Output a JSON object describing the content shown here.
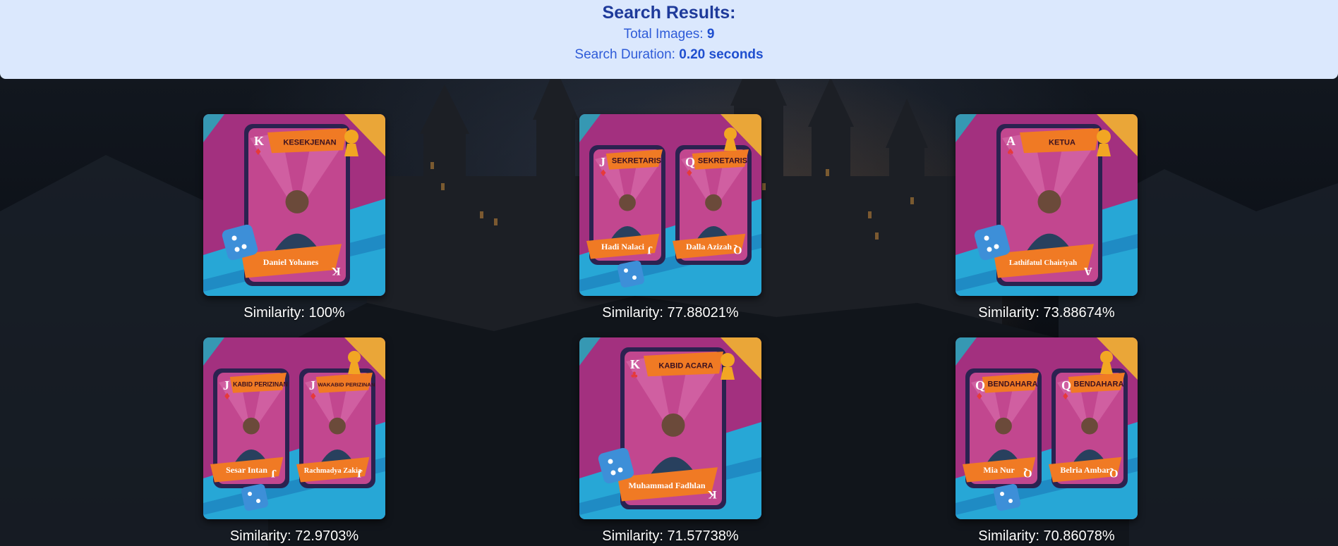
{
  "header": {
    "title": "Search Results:",
    "total_label": "Total Images: ",
    "total_value": "9",
    "duration_label": "Search Duration: ",
    "duration_value": "0.20 seconds"
  },
  "results": [
    {
      "similarity": "Similarity: 100%",
      "layout": "single",
      "cards": [
        {
          "rank": "K",
          "suit": "♦",
          "role": "KESEKJENAN",
          "name": "Daniel Yohanes"
        }
      ]
    },
    {
      "similarity": "Similarity: 77.88021%",
      "layout": "double",
      "cards": [
        {
          "rank": "J",
          "suit": "♦",
          "role": "SEKRETARIS",
          "name": "Hadi Nalaci"
        },
        {
          "rank": "Q",
          "suit": "♦",
          "role": "SEKRETARIS",
          "name": "Dalla Azizah"
        }
      ]
    },
    {
      "similarity": "Similarity: 73.88674%",
      "layout": "single",
      "cards": [
        {
          "rank": "A",
          "suit": "♠",
          "role": "KETUA",
          "name": "Lathifatul Chairiyah"
        }
      ]
    },
    {
      "similarity": "Similarity: 72.9703%",
      "layout": "double",
      "cards": [
        {
          "rank": "J",
          "suit": "♦",
          "role": "KABID PERIZINAN",
          "name": "Sesar Intan"
        },
        {
          "rank": "J",
          "suit": "♦",
          "role": "WAKABID PERIZINAN",
          "name": "Rachmadya Zakia"
        }
      ]
    },
    {
      "similarity": "Similarity: 71.57738%",
      "layout": "single",
      "cards": [
        {
          "rank": "K",
          "suit": "♣",
          "role": "KABID ACARA",
          "name": "Muhammad Fadhlan"
        }
      ]
    },
    {
      "similarity": "Similarity: 70.86078%",
      "layout": "double",
      "cards": [
        {
          "rank": "Q",
          "suit": "♦",
          "role": "BENDAHARA",
          "name": "Mia Nur"
        },
        {
          "rank": "Q",
          "suit": "♦",
          "role": "BENDAHARA",
          "name": "Belria Ambar"
        }
      ]
    }
  ],
  "colors": {
    "header_bg": "#dbe8fd",
    "header_text": "#2e5bd8",
    "card_magenta": "#a3307f",
    "card_cyan": "#27a7d6",
    "card_orange": "#f07a24",
    "card_navy": "#2b2250"
  }
}
